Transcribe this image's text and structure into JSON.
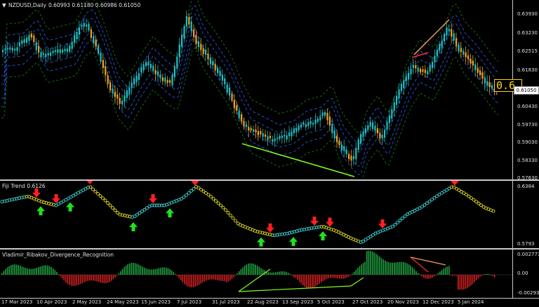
{
  "main": {
    "title": "NZDUSD,Daily",
    "ohlc": "0.60993 0.61180 0.60986 0.61050",
    "current_price": "0.61050",
    "big_label": "0.6",
    "yticks": [
      "0.63930",
      "0.63230",
      "0.62515",
      "0.61830",
      "0.61050",
      "0.60430",
      "0.59730",
      "0.59030",
      "0.58330",
      "0.57630"
    ]
  },
  "indicator1": {
    "title": "Fiji Trend 0.6126",
    "yticks": [
      "0.6384",
      "0.5793"
    ]
  },
  "indicator2": {
    "title": "Vladimir_Ribakov_Divergence_Recognition",
    "yticks": [
      "0.002773",
      "0.00",
      "-0.002933"
    ]
  },
  "xaxis": [
    "17 Mar 2023",
    "10 Apr 2023",
    "2 May 2023",
    "24 May 2023",
    "15 Jun 2023",
    "7 Jul 2023",
    "31 Jul 2023",
    "22 Aug 2023",
    "13 Sep 2023",
    "5 Oct 2023",
    "27 Oct 2023",
    "20 Nov 2023",
    "12 Dec 2023",
    "5 Jan 2024"
  ],
  "colors": {
    "bull": "#20c0c0",
    "bear": "#f0a020",
    "band_inner": "#2050c0",
    "band_outer": "#107010",
    "divergence_bull": "#80ff20",
    "divergence_bear": "#ff3030",
    "trend_up": "#40d8d8",
    "trend_down": "#e8e020",
    "arrow_up": "#20e020",
    "arrow_down": "#ff2020"
  }
}
